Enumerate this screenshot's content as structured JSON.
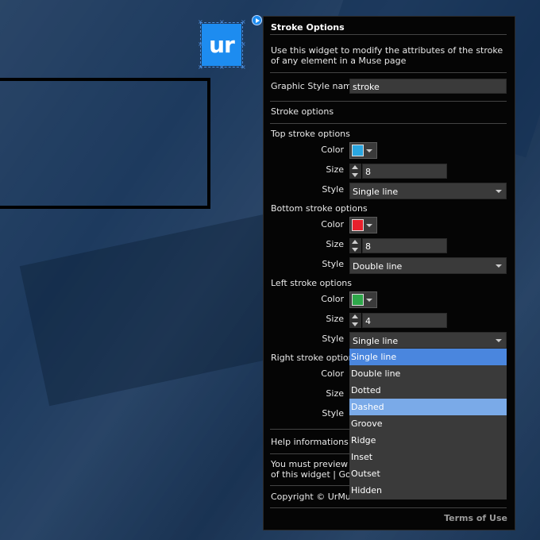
{
  "panel": {
    "title": "Stroke Options",
    "description": "Use this widget to modify the attributes of the stroke of any element in a Muse page",
    "graphic_style": {
      "label": "Graphic Style name",
      "value": "stroke"
    },
    "stroke_options_heading": "Stroke options",
    "labels": {
      "color": "Color",
      "size": "Size",
      "style": "Style"
    },
    "top": {
      "heading": "Top stroke options",
      "color": "#2aa6e0",
      "size": "8",
      "style": "Single line"
    },
    "bottom": {
      "heading": "Bottom stroke options",
      "color": "#e8202c",
      "size": "8",
      "style": "Double line"
    },
    "left": {
      "heading": "Left stroke options",
      "color": "#2ea84a",
      "size": "4",
      "style": "Single line"
    },
    "right": {
      "heading": "Right stroke options"
    },
    "help_heading": "Help informations",
    "help_text_1": "You must preview the",
    "help_text_2": "of this widget | Go to",
    "copyright": "Copyright © UrMuse",
    "terms": "Terms of Use"
  },
  "logo": {
    "text": "ur"
  },
  "dropdown": {
    "options": [
      "Single line",
      "Double line",
      "Dotted",
      "Dashed",
      "Groove",
      "Ridge",
      "Inset",
      "Outset",
      "Hidden"
    ],
    "selected": "Single line",
    "hovered": "Dashed"
  },
  "colors": {
    "accent": "#1d8cf0",
    "highlight": "#4a86de",
    "hover": "#7aaae8"
  }
}
